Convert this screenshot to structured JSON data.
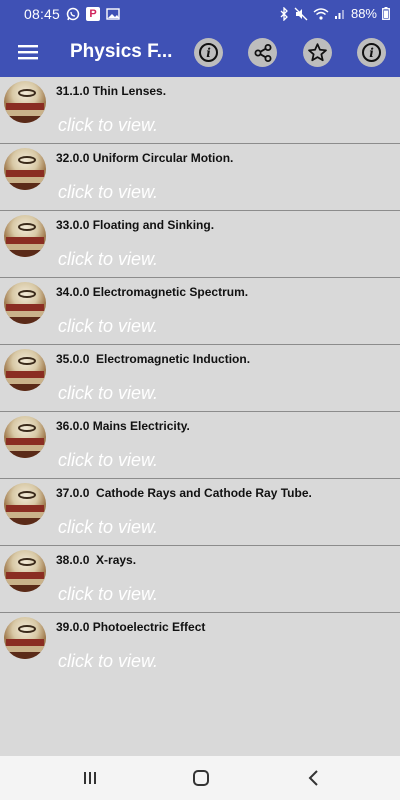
{
  "status_bar": {
    "time": "08:45",
    "battery": "88%",
    "left_icons": [
      "whatsapp-icon",
      "p-badge-icon",
      "image-icon"
    ],
    "right_icons": [
      "bluetooth-icon",
      "mute-icon",
      "wifi-icon",
      "signal-icon",
      "battery-icon"
    ],
    "p_badge": "P"
  },
  "app_bar": {
    "title": "Physics F...",
    "actions": [
      "info-icon",
      "share-icon",
      "star-icon",
      "info-icon"
    ]
  },
  "list": {
    "items": [
      {
        "title": "31.1.0 Thin Lenses.",
        "subtitle": "click to view."
      },
      {
        "title": "32.0.0 Uniform Circular Motion.",
        "subtitle": "click to view."
      },
      {
        "title": "33.0.0 Floating and Sinking.",
        "subtitle": "click to view."
      },
      {
        "title": "34.0.0 Electromagnetic Spectrum.",
        "subtitle": "click to view."
      },
      {
        "title": "35.0.0  Electromagnetic Induction.",
        "subtitle": "click to view."
      },
      {
        "title": "36.0.0 Mains Electricity.",
        "subtitle": "click to view."
      },
      {
        "title": "37.0.0  Cathode Rays and Cathode Ray Tube.",
        "subtitle": "click to view."
      },
      {
        "title": "38.0.0  X-rays.",
        "subtitle": "click to view."
      },
      {
        "title": "39.0.0 Photoelectric Effect",
        "subtitle": "click to view."
      }
    ]
  },
  "nav_bar": {
    "buttons": [
      "recents-icon",
      "home-icon",
      "back-icon"
    ]
  },
  "colors": {
    "primary": "#3f51b5",
    "list_background": "#d9d9d9",
    "subtitle_text": "#ffffff"
  }
}
